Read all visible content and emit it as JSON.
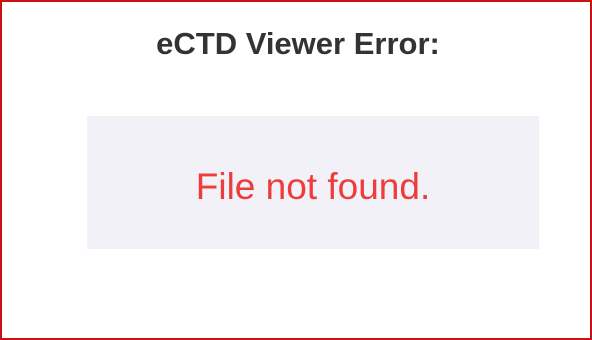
{
  "dialog": {
    "title": "eCTD Viewer Error:",
    "message": "File not found."
  },
  "colors": {
    "border": "#cc1111",
    "title_text": "#333333",
    "panel_background": "#f1f1f7",
    "error_text": "#ee3b3b"
  }
}
